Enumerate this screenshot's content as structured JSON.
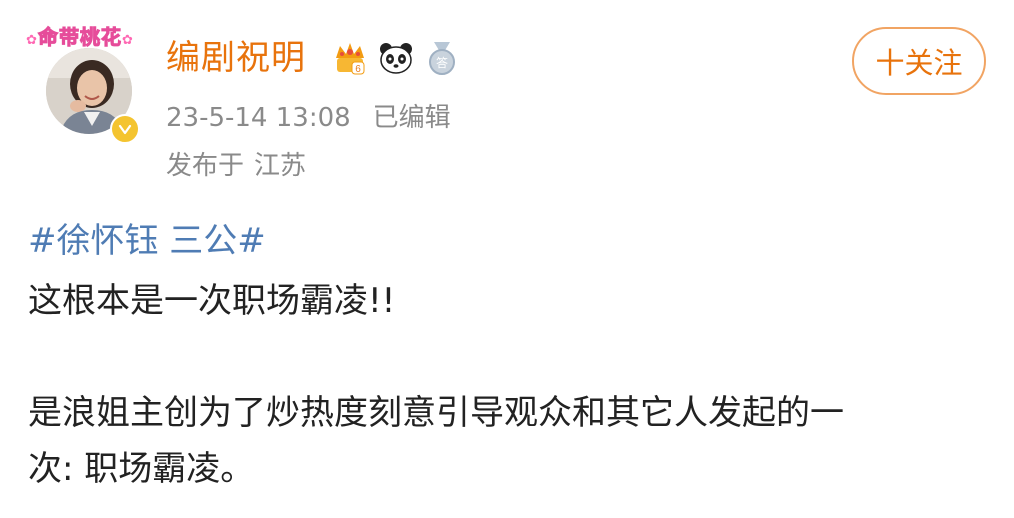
{
  "author": {
    "frame_text": "命带桃花",
    "username": "编剧祝明",
    "verified": true,
    "badges": [
      "crown-level-icon",
      "panda-icon",
      "medal-icon"
    ],
    "crown_level": "6",
    "medal_text": "答",
    "post_time": "23-5-14 13:08",
    "edited_label": "已编辑",
    "location_prefix": "发布于",
    "location": "江苏"
  },
  "follow_button": {
    "label": "十关注"
  },
  "content": {
    "hashtag": "#徐怀钰 三公#",
    "line1": "这根本是一次职场霸凌!!",
    "line2": "是浪姐主创为了炒热度刻意引导观众和其它人发起的一",
    "line3": "次: 职场霸凌。"
  },
  "colors": {
    "username": "#e8730c",
    "meta": "#8a8a8a",
    "hashtag": "#4f7cb4",
    "body_text": "#222222",
    "follow_border": "#f1a463",
    "verified_badge": "#f4c430"
  }
}
